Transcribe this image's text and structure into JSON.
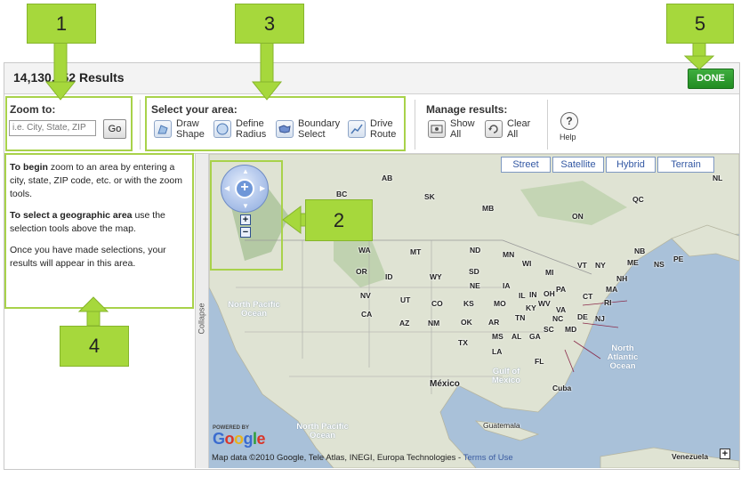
{
  "header": {
    "results_title": "14,130,452  Results",
    "done_label": "DONE"
  },
  "toolbar": {
    "zoom_title": "Zoom to:",
    "zoom_placeholder": "i.e. City, State, ZIP",
    "go_label": "Go",
    "select_title": "Select your area:",
    "tools": [
      {
        "line1": "Draw",
        "line2": "Shape",
        "icon": "draw-shape-icon"
      },
      {
        "line1": "Define",
        "line2": "Radius",
        "icon": "radius-icon"
      },
      {
        "line1": "Boundary",
        "line2": "Select",
        "icon": "boundary-icon"
      },
      {
        "line1": "Drive",
        "line2": "Route",
        "icon": "route-icon"
      }
    ],
    "manage_title": "Manage results:",
    "show_all": {
      "line1": "Show",
      "line2": "All"
    },
    "clear_all": {
      "line1": "Clear",
      "line2": "All"
    },
    "help_label": "Help",
    "help_glyph": "?"
  },
  "left_panel": {
    "p1_bold": "To begin",
    "p1_rest": " zoom to an area by entering a city, state, ZIP code, etc. or with the zoom tools.",
    "p2_bold": "To select a geographic area",
    "p2_rest": " use the selection tools above the map.",
    "p3": "Once you have made selections, your results will appear in this area.",
    "collapse_label": "Collapse"
  },
  "map": {
    "types": [
      "Street",
      "Satellite",
      "Hybrid",
      "Terrain"
    ],
    "labels": [
      "AB",
      "BC",
      "SK",
      "MB",
      "ON",
      "QC",
      "NL",
      "WA",
      "MT",
      "ND",
      "MN",
      "OR",
      "ID",
      "WY",
      "SD",
      "WI",
      "MI",
      "NY",
      "ME",
      "NB",
      "NS",
      "PE",
      "NV",
      "UT",
      "CO",
      "NE",
      "IA",
      "IL",
      "IN",
      "OH",
      "PA",
      "VT",
      "NH",
      "MA",
      "RI",
      "CT",
      "NJ",
      "DE",
      "MD",
      "VA",
      "WV",
      "CA",
      "AZ",
      "NM",
      "KS",
      "MO",
      "KY",
      "TN",
      "NC",
      "OK",
      "AR",
      "SC",
      "MS",
      "AL",
      "GA",
      "TX",
      "LA",
      "FL"
    ],
    "oceans": [
      {
        "name": "North Pacific Ocean"
      },
      {
        "name": "North Pacific Ocean"
      },
      {
        "name": "North Atlantic Ocean"
      },
      {
        "name": "Gulf of Mexico"
      }
    ],
    "places": [
      "México",
      "Cuba",
      "Guatemala",
      "Venezuela"
    ],
    "powered_by": "POWERED BY",
    "google_logo": "Google",
    "attribution": "Map data ©2010 Google, Tele Atlas, INEGI, Europa Technologies - ",
    "terms_link": "Terms of Use",
    "zoom_in": "+",
    "zoom_out": "−",
    "expand": "+"
  },
  "callouts": [
    "1",
    "2",
    "3",
    "4",
    "5"
  ],
  "colors": {
    "callout": "#a6d83c",
    "highlight": "#a8d24a",
    "done": "#2f9e2f",
    "map_water": "#a9c1d9"
  }
}
